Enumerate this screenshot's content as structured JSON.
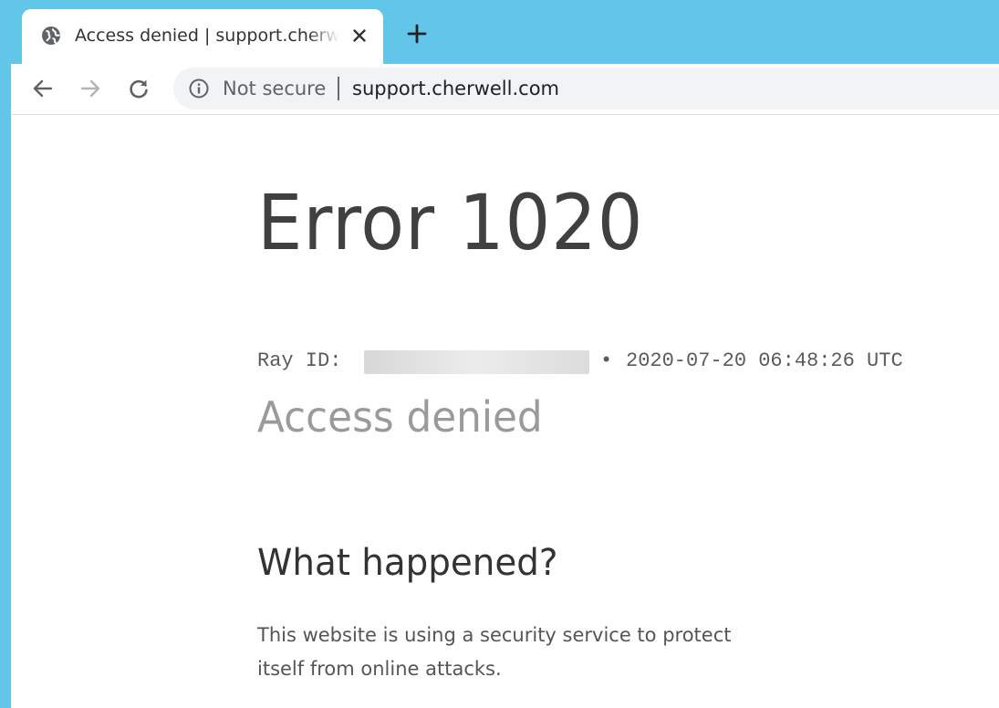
{
  "browser": {
    "tab": {
      "title": "Access denied | support.cherwell.com"
    },
    "omnibox": {
      "security_label": "Not secure",
      "url": "support.cherwell.com"
    }
  },
  "page": {
    "error_title": "Error 1020",
    "ray": {
      "label": "Ray ID:",
      "separator": "•",
      "timestamp": "2020-07-20 06:48:26 UTC"
    },
    "heading": "Access denied",
    "section_title": "What happened?",
    "explanation": "This website is using a security service to protect itself from online attacks."
  },
  "colors": {
    "tab_strip": "#62c6e8",
    "omnibox_bg": "#f1f3f4",
    "error_title": "#404040",
    "heading": "#9a9a9a"
  },
  "icons": {
    "favicon": "globe-icon",
    "close": "close-icon",
    "new_tab": "plus-icon",
    "back": "arrow-left-icon",
    "forward": "arrow-right-icon",
    "reload": "reload-icon",
    "security": "info-icon"
  }
}
